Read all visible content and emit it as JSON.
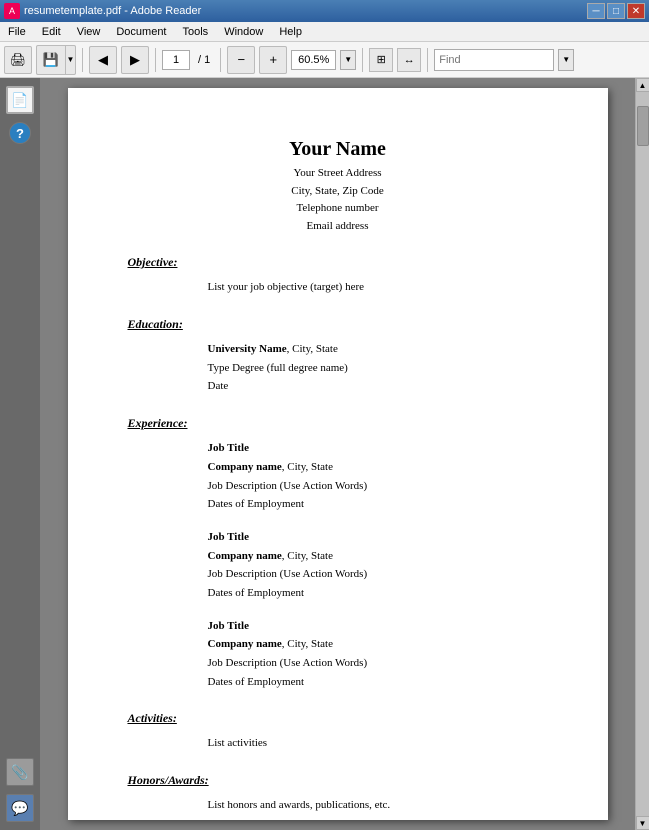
{
  "titlebar": {
    "title": "resumetemplate.pdf - Adobe Reader",
    "buttons": {
      "minimize": "─",
      "maximize": "□",
      "close": "✕"
    }
  },
  "menubar": {
    "items": [
      "File",
      "Edit",
      "View",
      "Document",
      "Tools",
      "Window",
      "Help"
    ]
  },
  "toolbar": {
    "page_current": "1",
    "page_total": "/ 1",
    "zoom_level": "60.5%",
    "find_placeholder": "Find"
  },
  "resume": {
    "name": "Your Name",
    "street": "Your Street Address",
    "city_state_zip": "City, State, Zip Code",
    "telephone": "Telephone number",
    "email": "Email address",
    "sections": {
      "objective": {
        "heading": "Objective:",
        "content": "List your job objective (target) here"
      },
      "education": {
        "heading": "Education:",
        "university": "University Name",
        "university_suffix": ", City, State",
        "degree": "Type Degree (full degree name)",
        "date": "Date"
      },
      "experience": {
        "heading": "Experience:",
        "jobs": [
          {
            "title": "Job Title",
            "company": "Company name",
            "company_suffix": ", City, State",
            "description": "Job Description (Use Action Words)",
            "dates": "Dates of Employment"
          },
          {
            "title": "Job Title",
            "company": "Company name",
            "company_suffix": ", City, State",
            "description": "Job Description (Use Action Words)",
            "dates": "Dates of Employment"
          },
          {
            "title": "Job Title",
            "company": "Company name",
            "company_suffix": ", City, State",
            "description": "Job Description (Use Action Words)",
            "dates": "Dates of Employment"
          }
        ]
      },
      "activities": {
        "heading": "Activities:",
        "content": "List activities"
      },
      "honors": {
        "heading": "Honors/Awards:",
        "content": "List honors and awards, publications, etc."
      }
    }
  }
}
